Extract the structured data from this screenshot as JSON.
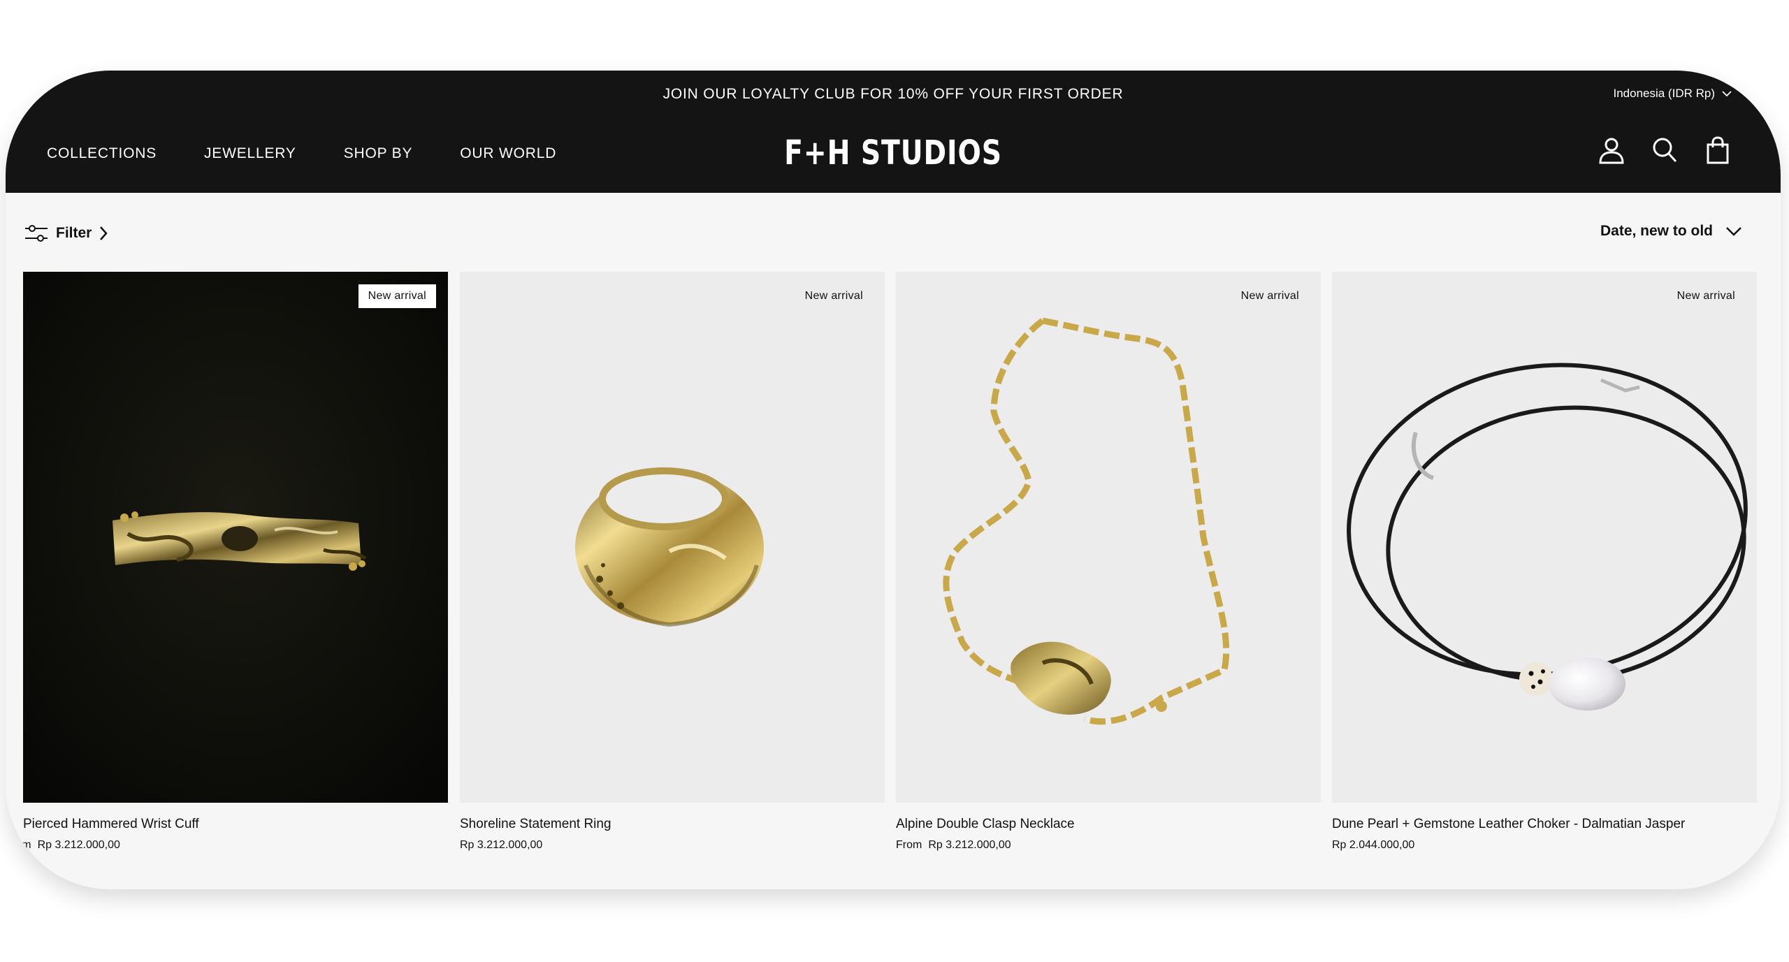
{
  "header": {
    "announcement": "JOIN OUR LOYALTY CLUB FOR 10% OFF YOUR FIRST ORDER",
    "country": "Indonesia (IDR Rp)",
    "logo": "F+H STUDIOS",
    "nav": [
      "COLLECTIONS",
      "JEWELLERY",
      "SHOP BY",
      "OUR WORLD"
    ],
    "icons": [
      "account-icon",
      "search-icon",
      "bag-icon"
    ]
  },
  "toolbar": {
    "filter_label": "Filter",
    "sort_label": "Date, new to old"
  },
  "products": [
    {
      "name": "Pierced Hammered Wrist Cuff",
      "from": "rom",
      "price": "Rp 3.212.000,00",
      "badge": "New arrival"
    },
    {
      "name": "Shoreline Statement Ring",
      "from": "",
      "price": "Rp 3.212.000,00",
      "badge": "New arrival"
    },
    {
      "name": "Alpine Double Clasp Necklace",
      "from": "From",
      "price": "Rp 3.212.000,00",
      "badge": "New arrival"
    },
    {
      "name": "Dune Pearl + Gemstone Leather Choker - Dalmatian Jasper",
      "from": "",
      "price": "Rp 2.044.000,00",
      "badge": "New arrival"
    }
  ],
  "colors": {
    "header_bg": "#141414",
    "page_bg": "#f6f6f6",
    "gold": "#c9a84a"
  }
}
